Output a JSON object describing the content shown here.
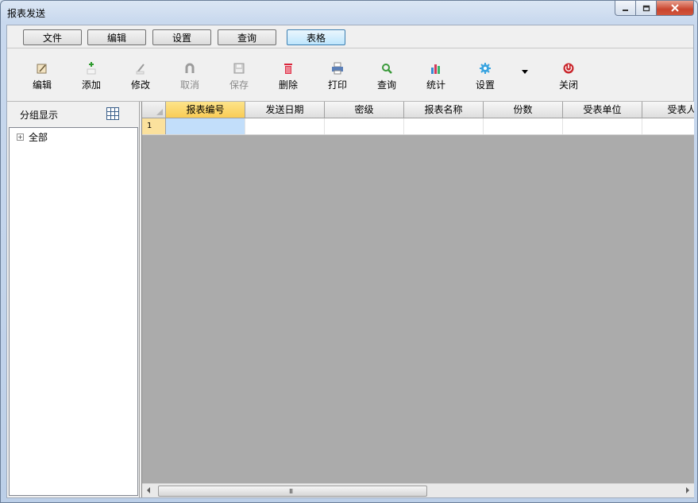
{
  "window": {
    "title": "报表发送"
  },
  "menubar": {
    "items": [
      {
        "label": "文件"
      },
      {
        "label": "编辑"
      },
      {
        "label": "设置"
      },
      {
        "label": "查询"
      },
      {
        "label": "表格"
      }
    ]
  },
  "toolbar": {
    "items": [
      {
        "label": "编辑",
        "icon": "edit-icon"
      },
      {
        "label": "添加",
        "icon": "add-icon"
      },
      {
        "label": "修改",
        "icon": "modify-icon"
      },
      {
        "label": "取消",
        "icon": "undo-icon"
      },
      {
        "label": "保存",
        "icon": "save-icon"
      },
      {
        "label": "删除",
        "icon": "trash-icon"
      },
      {
        "label": "打印",
        "icon": "printer-icon"
      },
      {
        "label": "查询",
        "icon": "search-icon"
      },
      {
        "label": "统计",
        "icon": "bar-chart-icon"
      },
      {
        "label": "设置",
        "icon": "gear-icon"
      },
      {
        "label": "关闭",
        "icon": "power-icon"
      }
    ]
  },
  "leftpanel": {
    "title": "分组显示",
    "tree": [
      {
        "label": "全部"
      }
    ]
  },
  "grid": {
    "columns": [
      "报表编号",
      "发送日期",
      "密级",
      "报表名称",
      "份数",
      "受表单位",
      "受表人"
    ],
    "rows": [
      {
        "number": "1"
      }
    ],
    "scroll_grip": "III"
  },
  "colors": {
    "selected_header": "#f9cc56",
    "selected_cell": "#c2defa",
    "empty_area": "#ababab",
    "close_button": "#c9452e"
  }
}
